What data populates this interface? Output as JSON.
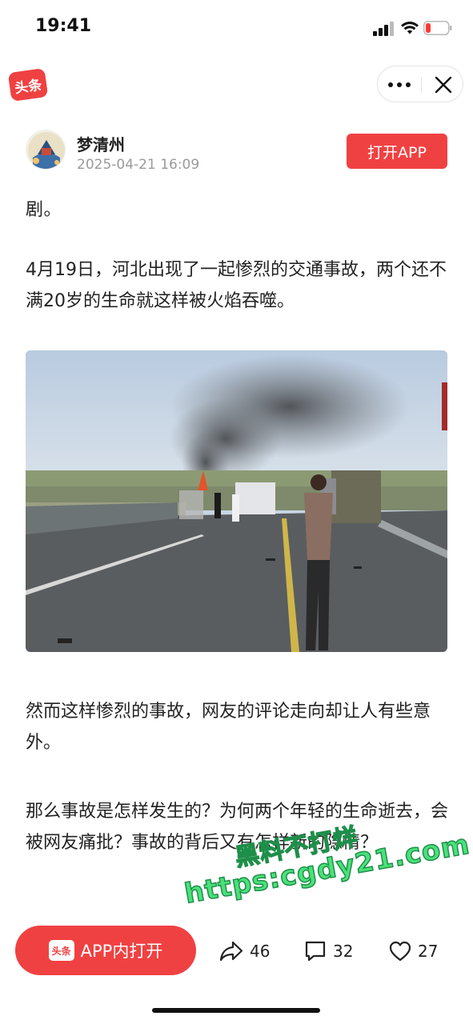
{
  "status_bar": {
    "time": "19:41"
  },
  "header": {
    "app_logo_text": "头条"
  },
  "author": {
    "name": "梦清州",
    "post_time": "2025-04-21 16:09",
    "open_app_label": "打开APP"
  },
  "article": {
    "paragraphs": [
      "剧。",
      "4月19日，河北出现了一起惨烈的交通事故，两个还不满20岁的生命就这样被火焰吞噬。",
      "然而这样惨烈的事故，网友的评论走向却让人有些意外。",
      "那么事故是怎样发生的？为何两个年轻的生命逝去，会被网友痛批？事故的背后又有怎样新的隐情？"
    ]
  },
  "watermark": {
    "line1": "黑料不打烊",
    "line2": "https:cgdy21.com"
  },
  "bottom_bar": {
    "pill_logo_text": "头条",
    "app_open_label": "APP内打开",
    "share_count": "46",
    "comment_count": "32",
    "like_count": "27"
  },
  "colors": {
    "accent": "#f04142",
    "watermark": "#4be07a"
  }
}
